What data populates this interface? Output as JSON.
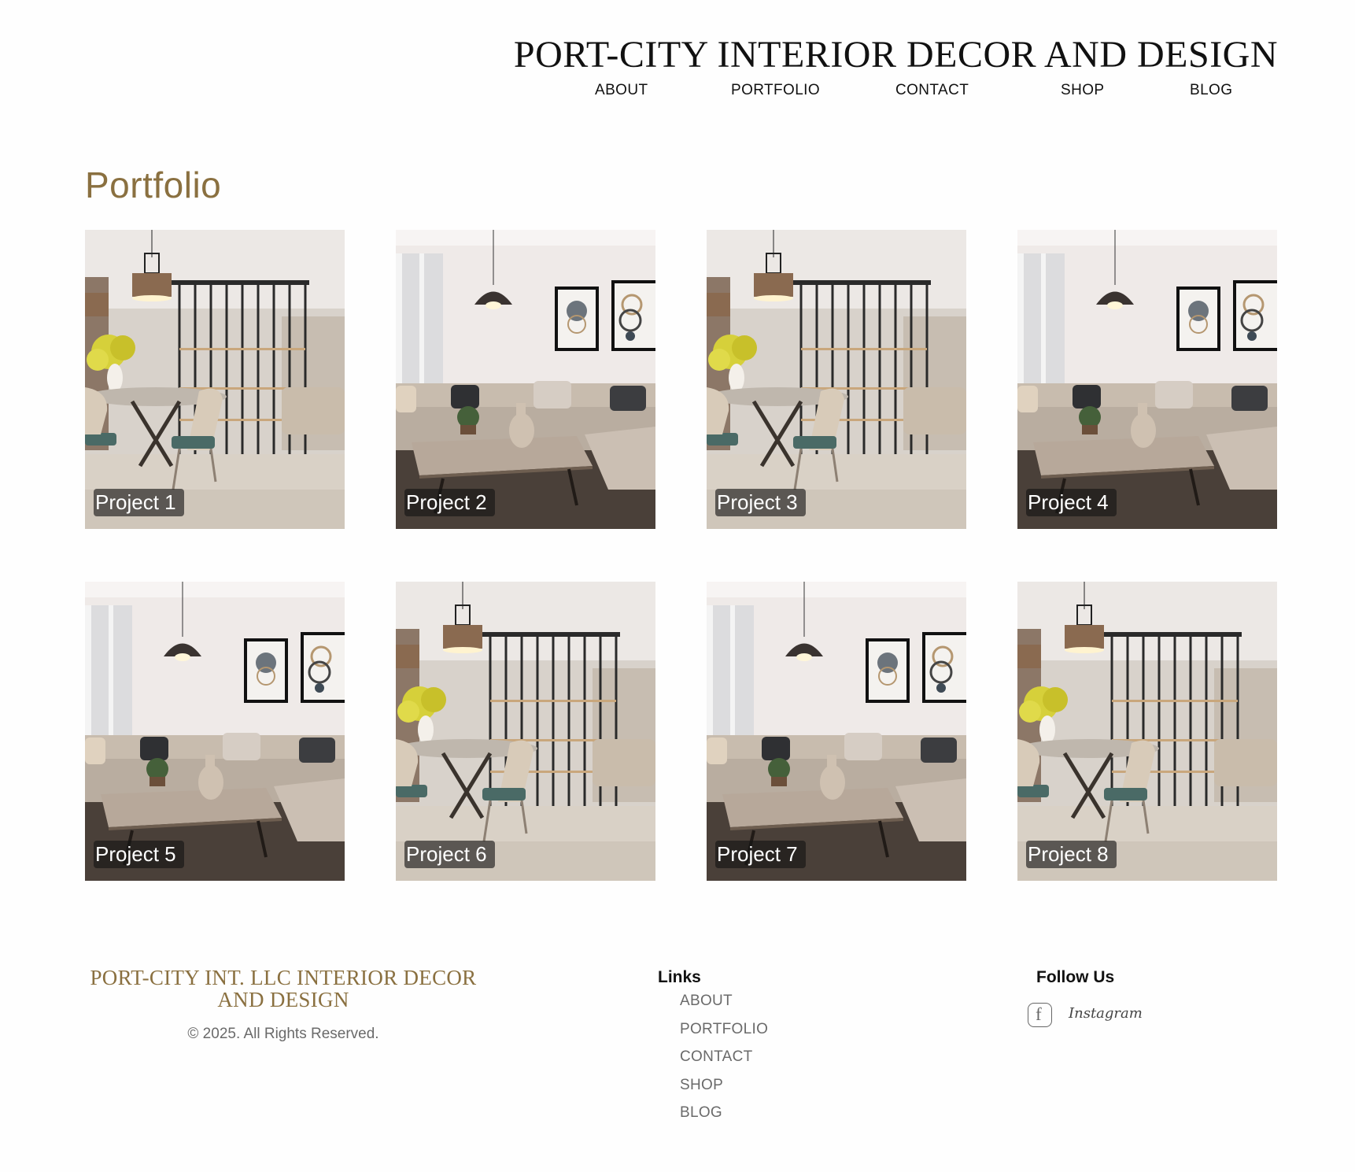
{
  "header": {
    "site_title": "PORT-CITY INTERIOR DECOR AND DESIGN",
    "nav": [
      "ABOUT",
      "PORTFOLIO",
      "CONTACT",
      "SHOP",
      "BLOG"
    ]
  },
  "main": {
    "title": "Portfolio",
    "projects": [
      {
        "label": "Project 1",
        "scene": "dining"
      },
      {
        "label": "Project 2",
        "scene": "living"
      },
      {
        "label": "Project 3",
        "scene": "dining"
      },
      {
        "label": "Project 4",
        "scene": "living"
      },
      {
        "label": "Project 5",
        "scene": "living"
      },
      {
        "label": "Project 6",
        "scene": "dining"
      },
      {
        "label": "Project 7",
        "scene": "living"
      },
      {
        "label": "Project 8",
        "scene": "dining"
      }
    ]
  },
  "footer": {
    "brand_line1": "PORT-CITY INT. LLC INTERIOR DECOR",
    "brand_line2": "AND DESIGN",
    "copyright": "© 2025. All Rights Reserved.",
    "links_heading": "Links",
    "links": [
      "ABOUT",
      "PORTFOLIO",
      "CONTACT",
      "SHOP",
      "BLOG"
    ],
    "follow_heading": "Follow Us",
    "social": {
      "facebook_icon": "facebook-icon",
      "instagram_text": "Instagram"
    }
  },
  "colors": {
    "accent": "#8a7040",
    "text": "#111111",
    "muted": "#6a6a6a"
  }
}
